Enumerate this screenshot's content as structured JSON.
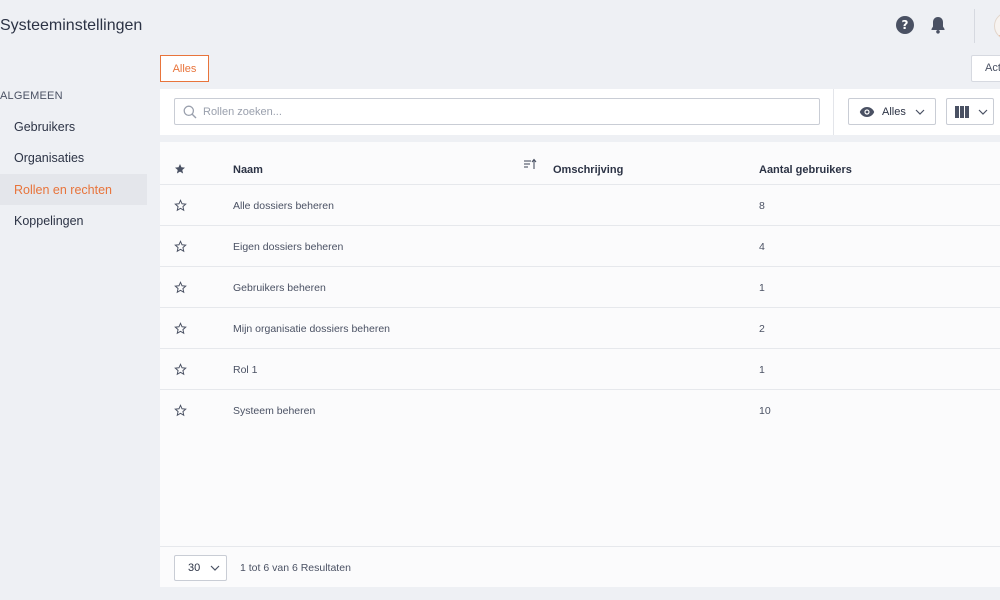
{
  "header": {
    "title": "Systeeminstellingen"
  },
  "tabs": [
    {
      "label": "Alles"
    }
  ],
  "actions": {
    "label": "Act"
  },
  "sidebar": {
    "heading": "ALGEMEEN",
    "items": [
      {
        "label": "Gebruikers"
      },
      {
        "label": "Organisaties"
      },
      {
        "label": "Rollen en rechten"
      },
      {
        "label": "Koppelingen"
      }
    ],
    "active_item": "Rollen en rechten"
  },
  "search": {
    "placeholder": "Rollen zoeken...",
    "value": ""
  },
  "filter": {
    "label": "Alles",
    "icon": "eye-icon"
  },
  "columns_button": {
    "icon": "columns-icon"
  },
  "table": {
    "columns": [
      "Naam",
      "Omschrijving",
      "Aantal gebruikers"
    ],
    "rows": [
      {
        "name": "Alle dossiers beheren",
        "description": "",
        "count": "8"
      },
      {
        "name": "Eigen dossiers beheren",
        "description": "",
        "count": "4"
      },
      {
        "name": "Gebruikers beheren",
        "description": "",
        "count": "1"
      },
      {
        "name": "Mijn organisatie dossiers beheren",
        "description": "",
        "count": "2"
      },
      {
        "name": "Rol 1",
        "description": "",
        "count": "1"
      },
      {
        "name": "Systeem beheren",
        "description": "",
        "count": "10"
      }
    ]
  },
  "pagination": {
    "page_size": "30",
    "summary": "1 tot 6 van 6 Resultaten"
  },
  "colors": {
    "accent": "#e8743b",
    "text": "#2c3345",
    "background": "#eef0f4"
  }
}
